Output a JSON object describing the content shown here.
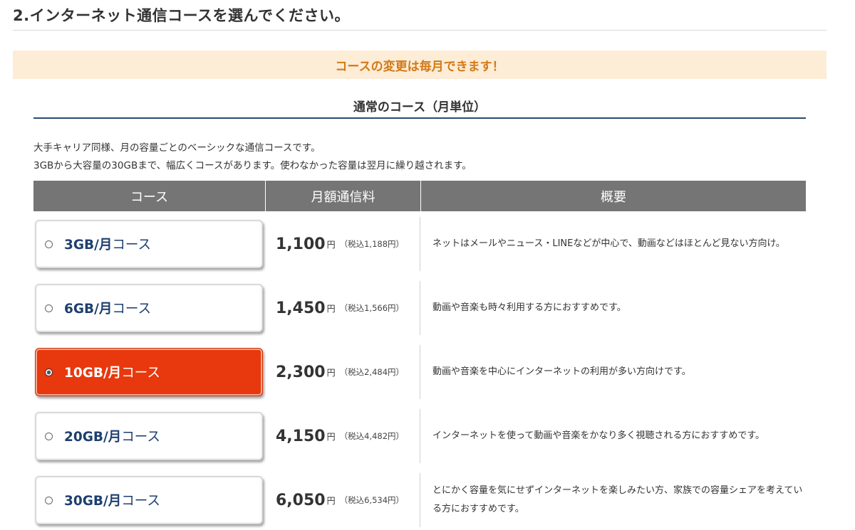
{
  "page": {
    "title": "2.インターネット通信コースを選んでください。",
    "notice": "コースの変更は毎月できます！",
    "section_heading": "通常のコース（月単位）",
    "description": [
      "大手キャリア同様、月の容量ごとのベーシックな通信コースです。",
      "3GBから大容量の30GBまで、幅広くコースがあります。使わなかった容量は翌月に繰り越されます。"
    ]
  },
  "table": {
    "headers": [
      "コース",
      "月額通信料",
      "概要"
    ],
    "rows": [
      {
        "course_bold": "3GB/月",
        "course_suffix": "コース",
        "price": "1,100",
        "yen": "円",
        "tax": "（税込1,188円）",
        "summary": "ネットはメールやニュース・LINEなどが中心で、動画などはほとんど見ない方向け。",
        "selected": false
      },
      {
        "course_bold": "6GB/月",
        "course_suffix": "コース",
        "price": "1,450",
        "yen": "円",
        "tax": "（税込1,566円）",
        "summary": "動画や音楽も時々利用する方におすすめです。",
        "selected": false
      },
      {
        "course_bold": "10GB/月",
        "course_suffix": "コース",
        "price": "2,300",
        "yen": "円",
        "tax": "（税込2,484円）",
        "summary": "動画や音楽を中心にインターネットの利用が多い方向けです。",
        "selected": true
      },
      {
        "course_bold": "20GB/月",
        "course_suffix": "コース",
        "price": "4,150",
        "yen": "円",
        "tax": "（税込4,482円）",
        "summary": "インターネットを使って動画や音楽をかなり多く視聴される方におすすめです。",
        "selected": false
      },
      {
        "course_bold": "30GB/月",
        "course_suffix": "コース",
        "price": "6,050",
        "yen": "円",
        "tax": "（税込6,534円）",
        "summary": "とにかく容量を気にせずインターネットを楽しみたい方、家族での容量シェアを考えている方におすすめです。",
        "selected": false
      }
    ]
  },
  "colors": {
    "selected_bg": "#e8380d",
    "header_bg": "#757575",
    "notice_bg": "#fdecd6",
    "notice_text": "#d27a16",
    "course_text": "#1e3f6e"
  }
}
